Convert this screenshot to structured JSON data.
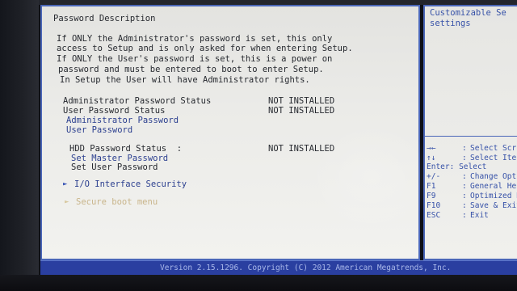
{
  "help_panel": {
    "description_line1": "Customizable Se",
    "description_line2": "settings",
    "keys": [
      {
        "key": "→←",
        "desc": "Select Scr"
      },
      {
        "key": "↑↓",
        "desc": "Select Ite"
      },
      {
        "key": "Enter",
        "desc": "Select"
      },
      {
        "key": "+/-",
        "desc": "Change Opt"
      },
      {
        "key": "F1",
        "desc": "General He"
      },
      {
        "key": "F9",
        "desc": "Optimized D"
      },
      {
        "key": "F10",
        "desc": "Save & Exit"
      },
      {
        "key": "ESC",
        "desc": "Exit"
      }
    ]
  },
  "main": {
    "section_title": "Password Description",
    "description": [
      "If ONLY the Administrator's password is set, this only",
      "access to Setup and is only asked for when entering Setup.",
      "If ONLY the User's password is set, this is a power on",
      "password and must be entered to boot to enter Setup.",
      "In Setup the User will have Administrator rights."
    ],
    "admin_status_label": "Administrator Password Status",
    "admin_status_value": "NOT INSTALLED",
    "user_status_label": "User Password Status",
    "user_status_value": "NOT INSTALLED",
    "admin_password_item": "Administrator Password",
    "user_password_item": "User Password",
    "hdd_status_label": "HDD Password Status  :",
    "hdd_status_value": "NOT INSTALLED",
    "set_master_item": "Set Master Password",
    "set_user_item": "Set User Password",
    "io_security_item": "I/O Interface Security",
    "secure_boot_item": "Secure boot menu",
    "submenu_arrow": "►"
  },
  "footer": {
    "version": "Version 2.15.1296. Copyright (C) 2012 American Megatrends, Inc."
  },
  "colors": {
    "bios_border": "#4a66b8",
    "help_text": "#3651a8",
    "selected_item": "#c9b58a",
    "version_bar": "#2a3fa0"
  }
}
